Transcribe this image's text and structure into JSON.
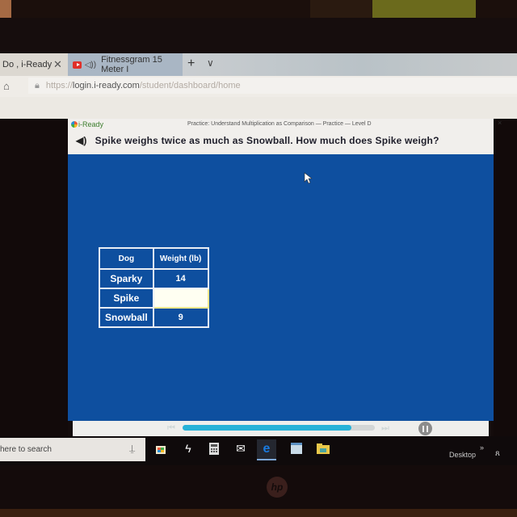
{
  "browser": {
    "tabs": [
      {
        "label": "Do , i-Ready",
        "active": false
      },
      {
        "label": "Fitnessgram 15 Meter I",
        "active": true,
        "audio_playing": true
      }
    ],
    "new_tab": "+",
    "tab_menu": "⌄",
    "close_tab": "✕",
    "url": {
      "prefix": "https://",
      "domain": "login.i-ready.com",
      "path": "/student/dashboard/home"
    },
    "home_icon": "⌂",
    "lock_icon": "🔒"
  },
  "app": {
    "logo": "i-Ready",
    "breadcrumb": "Practice: Understand Multiplication as Comparison — Practice — Level D",
    "close": "×",
    "question": "Spike weighs twice as much as Snowball. How much does Spike weigh?",
    "audio_icon": "🔈",
    "table": {
      "headers": [
        "Dog",
        "Weight (lb)"
      ],
      "rows": [
        {
          "dog": "Sparky",
          "weight": "14"
        },
        {
          "dog": "Spike",
          "weight": ""
        },
        {
          "dog": "Snowball",
          "weight": "9"
        }
      ]
    },
    "player": {
      "progress_percent": 88,
      "skip_back": "⏮",
      "skip_forward": "⏭"
    },
    "colors": {
      "stage": "#0e4f9f",
      "progress": "#26b2d8"
    }
  },
  "taskbar": {
    "search_placeholder": "here to search",
    "mic": "🎙",
    "icons": [
      "store-icon",
      "app-icon",
      "calculator-icon",
      "mail-icon",
      "edge-icon",
      "notepad-icon",
      "file-explorer-icon"
    ],
    "desktop_label": "Desktop",
    "overflow": "»",
    "people": "ጸ"
  },
  "device": {
    "brand": "hp"
  }
}
